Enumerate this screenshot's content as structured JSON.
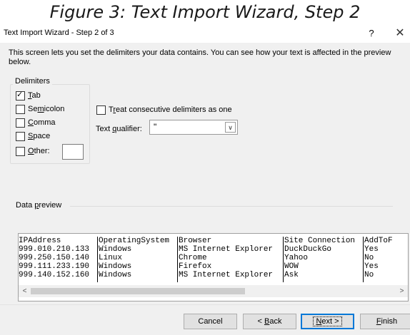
{
  "figure_caption": "Figure 3: Text Import Wizard, Step 2",
  "window": {
    "title": "Text Import Wizard - Step 2 of 3",
    "help_glyph": "?",
    "close_glyph": "✕"
  },
  "intro_text": "This screen lets you set the delimiters your data contains.  You can see how your text is affected in the preview below.",
  "delimiters": {
    "group_label": "Delimiters",
    "tab": {
      "accel": "T",
      "rest": "ab",
      "checked": true
    },
    "semicolon": {
      "pre": "Se",
      "accel": "m",
      "rest": "icolon",
      "checked": false
    },
    "comma": {
      "accel": "C",
      "rest": "omma",
      "checked": false
    },
    "space": {
      "accel": "S",
      "rest": "pace",
      "checked": false
    },
    "other": {
      "accel": "O",
      "rest": "ther:",
      "checked": false,
      "value": ""
    }
  },
  "consecutive": {
    "pre": "T",
    "accel": "r",
    "rest": "eat consecutive delimiters as one",
    "checked": false
  },
  "text_qualifier": {
    "pre": "Text ",
    "accel": "q",
    "rest": "ualifier:",
    "value": "\""
  },
  "data_preview": {
    "pre": "Data ",
    "accel": "p",
    "rest": "review",
    "rows": [
      [
        "IPAddress",
        "OperatingSystem",
        "Browser",
        "Site Connection",
        "AddToF"
      ],
      [
        "999.010.210.133",
        "Windows",
        "MS Internet Explorer",
        "DuckDuckGo",
        "Yes"
      ],
      [
        "999.250.150.140",
        "Linux",
        "Chrome",
        "Yahoo",
        "No"
      ],
      [
        "999.111.233.190",
        "Windows",
        "Firefox",
        "WOW",
        "Yes"
      ],
      [
        "999.140.152.160",
        "Windows",
        "MS Internet Explorer",
        "Ask",
        "No"
      ]
    ]
  },
  "buttons": {
    "cancel": "Cancel",
    "back": {
      "pre": "< ",
      "accel": "B",
      "rest": "ack"
    },
    "next": {
      "accel": "N",
      "rest": "ext >"
    },
    "finish": {
      "accel": "F",
      "rest": "inish"
    }
  },
  "scroll_glyphs": {
    "up": "∧",
    "down": "∨",
    "left": "<",
    "right": ">",
    "dropdown": "∨"
  },
  "colors": {
    "dialog_bg": "#f0f0f0",
    "default_button_border": "#0078d7"
  }
}
